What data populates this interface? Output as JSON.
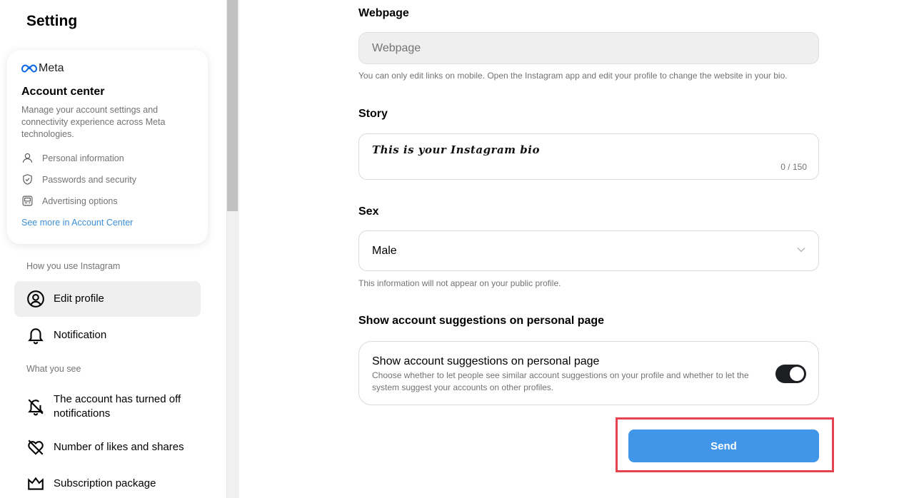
{
  "sidebar": {
    "title": "Setting",
    "account_center": {
      "brand": "Meta",
      "title": "Account center",
      "description": "Manage your account settings and connectivity experience across Meta technologies.",
      "items": [
        {
          "label": "Personal information",
          "icon": "person-icon"
        },
        {
          "label": "Passwords and security",
          "icon": "shield-check-icon"
        },
        {
          "label": "Advertising options",
          "icon": "ad-icon"
        }
      ],
      "link": "See more in Account Center"
    },
    "sections": [
      {
        "label": "How you use Instagram",
        "items": [
          {
            "label": "Edit profile",
            "icon": "profile-circle-icon",
            "active": true
          },
          {
            "label": "Notification",
            "icon": "bell-icon",
            "active": false
          }
        ]
      },
      {
        "label": "What you see",
        "items": [
          {
            "label": "The account has turned off notifications",
            "icon": "bell-off-icon"
          },
          {
            "label": "Number of likes and shares",
            "icon": "heart-off-icon"
          },
          {
            "label": "Subscription package",
            "icon": "crown-icon"
          }
        ]
      }
    ]
  },
  "main": {
    "webpage": {
      "label": "Webpage",
      "placeholder": "Webpage",
      "helper": "You can only edit links on mobile. Open the Instagram app and edit your profile to change the website in your bio."
    },
    "story": {
      "label": "Story",
      "value": "This is your Instagram bio",
      "counter": "0 / 150"
    },
    "sex": {
      "label": "Sex",
      "selected": "Male",
      "helper": "This information will not appear on your public profile."
    },
    "suggestions": {
      "section_label": "Show account suggestions on personal page",
      "title": "Show account suggestions on personal page",
      "description": "Choose whether to let people see similar account suggestions on your profile and whether to let the system suggest your accounts on other profiles.",
      "enabled": true
    },
    "send_label": "Send"
  },
  "colors": {
    "accent": "#4296ea",
    "link": "#3b8fd8",
    "highlight": "#e5434f",
    "toggle_on": "#1c1e21"
  }
}
